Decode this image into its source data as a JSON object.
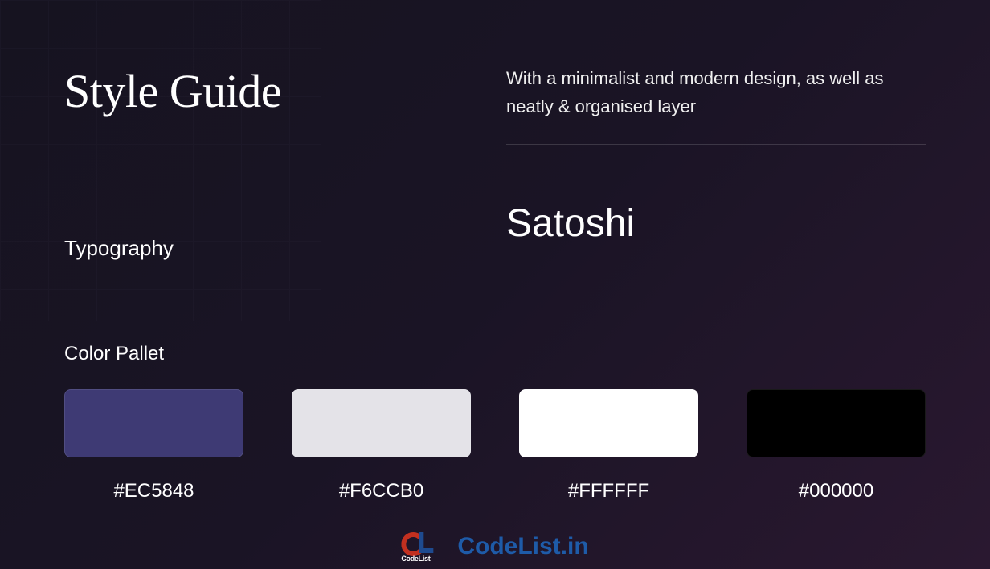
{
  "header": {
    "title": "Style Guide",
    "description": "With a minimalist and modern design, as well as neatly & organised layer"
  },
  "typography": {
    "label": "Typography",
    "font_name": "Satoshi"
  },
  "palette": {
    "label": "Color Pallet",
    "swatches": [
      {
        "hex_label": "#EC5848",
        "display_color": "#3e3a74"
      },
      {
        "hex_label": "#F6CCB0",
        "display_color": "#e4e3e8"
      },
      {
        "hex_label": "#FFFFFF",
        "display_color": "#ffffff"
      },
      {
        "hex_label": "#000000",
        "display_color": "#000000"
      }
    ]
  },
  "watermark": {
    "logo_text": "CodeList",
    "domain": "CodeList.in"
  }
}
